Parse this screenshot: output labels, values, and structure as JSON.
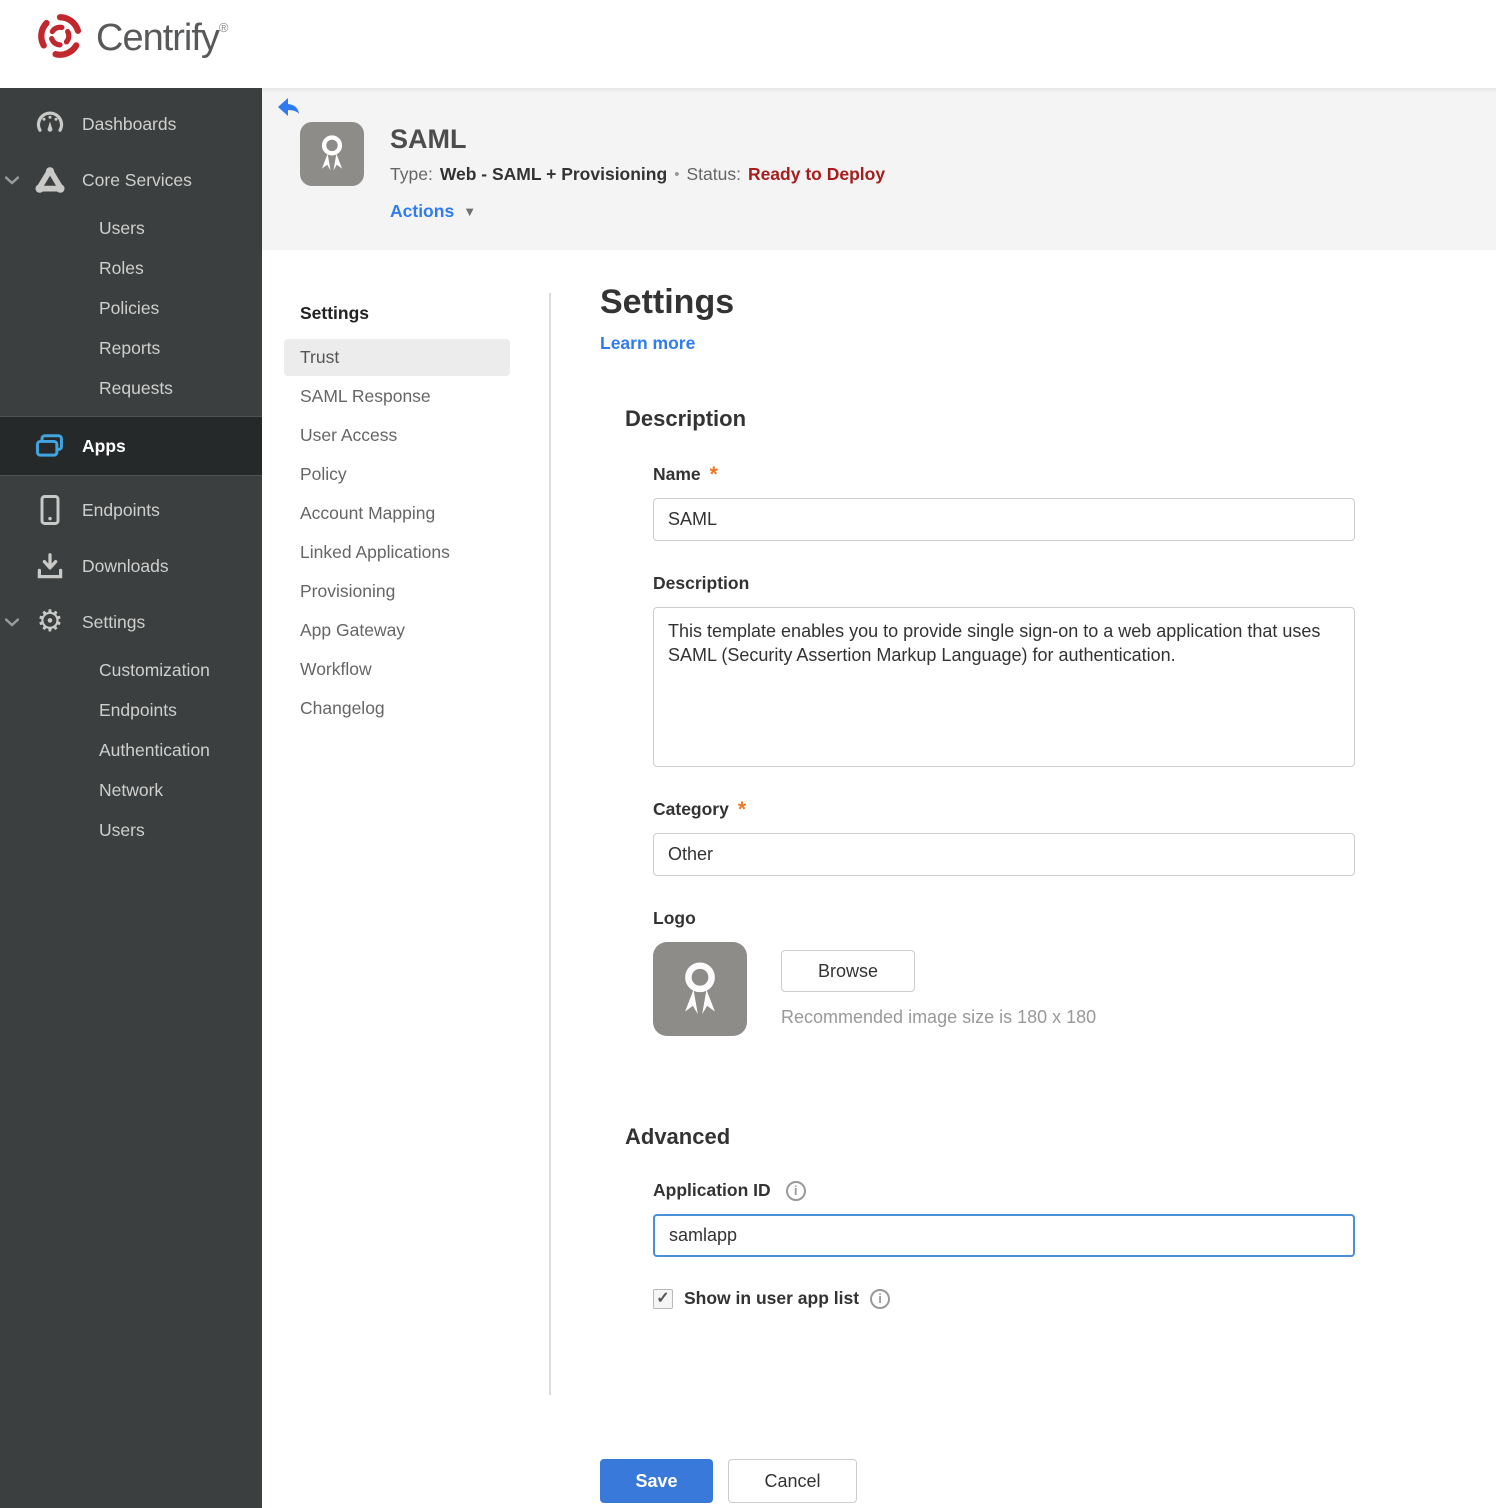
{
  "brand": {
    "name": "Centrify",
    "reg": "®"
  },
  "colors": {
    "brand_red": "#c1272d",
    "sidebar_bg": "#3b3f3f",
    "sidebar_active_bg": "#26292a",
    "apps_icon_blue": "#42a5e0",
    "header_bg": "#f4f4f4",
    "link_blue": "#2e7cf0",
    "status_red": "#a61d1d",
    "save_blue": "#3879d9",
    "required_orange": "#ee7624",
    "focused_border_blue": "#4a90d9"
  },
  "icons": {
    "check": "✓",
    "info": "i",
    "caret_down": "▼",
    "gear": "⚙",
    "required": "*",
    "dot_separator": "•"
  },
  "sidebar": {
    "dashboards": "Dashboards",
    "core_services": "Core Services",
    "core_children": [
      "Users",
      "Roles",
      "Policies",
      "Reports",
      "Requests"
    ],
    "apps": "Apps",
    "endpoints": "Endpoints",
    "downloads": "Downloads",
    "settings": "Settings",
    "settings_children": [
      "Customization",
      "Endpoints",
      "Authentication",
      "Network",
      "Users"
    ]
  },
  "header": {
    "app_name": "SAML",
    "type_label": "Type:",
    "type_value": "Web - SAML + Provisioning",
    "status_label": "Status:",
    "status_value": "Ready to Deploy",
    "actions_label": "Actions"
  },
  "subnav": {
    "title": "Settings",
    "active_item": "Trust",
    "items": [
      "Trust",
      "SAML Response",
      "User Access",
      "Policy",
      "Account Mapping",
      "Linked Applications",
      "Provisioning",
      "App Gateway",
      "Workflow",
      "Changelog"
    ]
  },
  "main": {
    "title": "Settings",
    "learn_more": "Learn more",
    "description_section": {
      "heading": "Description",
      "name_label": "Name",
      "name_value": "SAML",
      "description_label": "Description",
      "description_value": "This template enables you to provide single sign-on to a web application that uses SAML (Security Assertion Markup Language) for authentication.",
      "category_label": "Category",
      "category_value": "Other",
      "logo_label": "Logo",
      "browse_label": "Browse",
      "recommended_text": "Recommended image size is 180 x 180"
    },
    "advanced_section": {
      "heading": "Advanced",
      "application_id_label": "Application ID",
      "application_id_value": "samlapp",
      "show_in_user_app_list_label": "Show in user app list",
      "checkbox_checked": true
    },
    "footer": {
      "save_label": "Save",
      "cancel_label": "Cancel"
    }
  }
}
